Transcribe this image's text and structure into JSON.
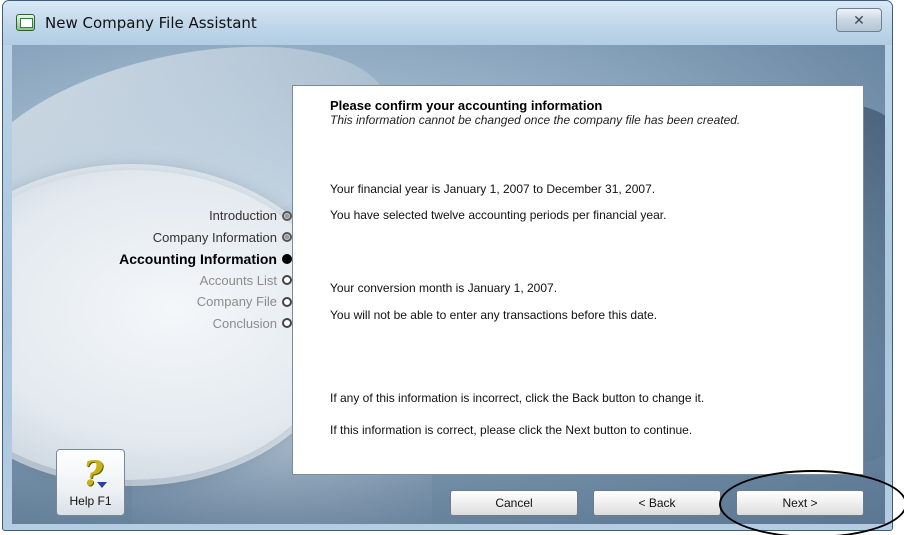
{
  "window": {
    "title": "New Company File Assistant",
    "close_glyph": "✕"
  },
  "steps": [
    {
      "label": "Introduction",
      "state": "done"
    },
    {
      "label": "Company Information",
      "state": "done"
    },
    {
      "label": "Accounting Information",
      "state": "active"
    },
    {
      "label": "Accounts List",
      "state": "future"
    },
    {
      "label": "Company File",
      "state": "future"
    },
    {
      "label": "Conclusion",
      "state": "future"
    }
  ],
  "panel": {
    "heading": "Please confirm your accounting information",
    "note": "This information cannot be changed once the company file has been created.",
    "financial_year": "Your financial year is January 1, 2007 to December 31, 2007.",
    "periods": "You have selected twelve accounting periods per financial year.",
    "conversion_month": "Your conversion month is January 1, 2007.",
    "conversion_warning": "You will not be able to enter any transactions before this date.",
    "incorrect_hint": "If any of this information is incorrect, click the Back button to change it.",
    "correct_hint": "If this information is correct, please click the Next button to continue."
  },
  "buttons": {
    "help": "Help F1",
    "cancel": "Cancel",
    "back": "< Back",
    "next": "Next >"
  },
  "icons": {
    "title": "company-file-icon",
    "help": "question-mark-icon",
    "close": "close-icon"
  }
}
